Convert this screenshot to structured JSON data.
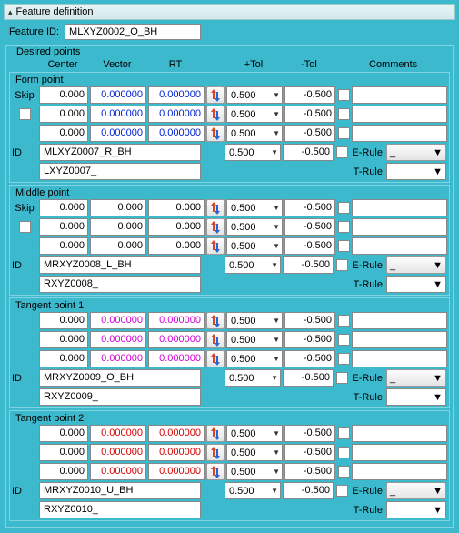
{
  "panel": {
    "title": "Feature definition"
  },
  "feature": {
    "id_label": "Feature ID:",
    "id_value": "MLXYZ0002_O_BH"
  },
  "desired": {
    "title": "Desired points",
    "headers": {
      "center": "Center",
      "vector": "Vector",
      "rt": "RT",
      "ptol": "+Tol",
      "mtol": "-Tol",
      "comments": "Comments"
    }
  },
  "labels": {
    "skip": "Skip",
    "id": "ID",
    "erule": "E-Rule",
    "trule": "T-Rule"
  },
  "tol": {
    "plus": "0.500",
    "minus": "-0.500"
  },
  "groups": [
    {
      "title": "Form point",
      "color": "blue",
      "rows": [
        {
          "center": "0.000",
          "vector": "0.000000",
          "rt": "0.000000"
        },
        {
          "center": "0.000",
          "vector": "0.000000",
          "rt": "0.000000"
        },
        {
          "center": "0.000",
          "vector": "0.000000",
          "rt": "0.000000"
        }
      ],
      "id1": "MLXYZ0007_R_BH",
      "id2": "LXYZ0007_"
    },
    {
      "title": "Middle point",
      "color": "",
      "rows": [
        {
          "center": "0.000",
          "vector": "0.000",
          "rt": "0.000"
        },
        {
          "center": "0.000",
          "vector": "0.000",
          "rt": "0.000"
        },
        {
          "center": "0.000",
          "vector": "0.000",
          "rt": "0.000"
        }
      ],
      "id1": "MRXYZ0008_L_BH",
      "id2": "RXYZ0008_"
    },
    {
      "title": "Tangent point 1",
      "color": "magenta",
      "rows": [
        {
          "center": "0.000",
          "vector": "0.000000",
          "rt": "0.000000"
        },
        {
          "center": "0.000",
          "vector": "0.000000",
          "rt": "0.000000"
        },
        {
          "center": "0.000",
          "vector": "0.000000",
          "rt": "0.000000"
        }
      ],
      "id1": "MRXYZ0009_O_BH",
      "id2": "RXYZ0009_"
    },
    {
      "title": "Tangent point 2",
      "color": "red",
      "rows": [
        {
          "center": "0.000",
          "vector": "0.000000",
          "rt": "0.000000"
        },
        {
          "center": "0.000",
          "vector": "0.000000",
          "rt": "0.000000"
        },
        {
          "center": "0.000",
          "vector": "0.000000",
          "rt": "0.000000"
        }
      ],
      "id1": "MRXYZ0010_U_BH",
      "id2": "RXYZ0010_"
    }
  ]
}
